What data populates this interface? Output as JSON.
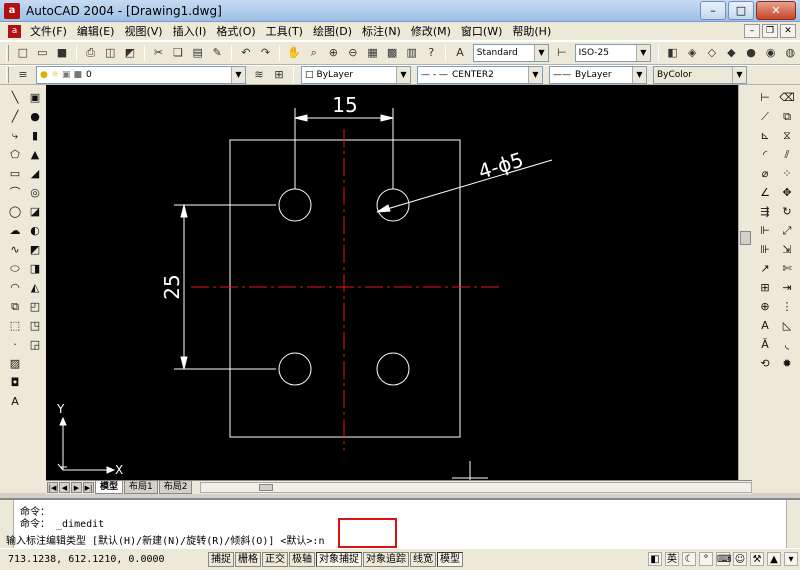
{
  "window": {
    "title": "AutoCAD 2004 - [Drawing1.dwg]",
    "app_icon": "autocad-icon",
    "controls": [
      "minimize-icon",
      "maximize-icon",
      "close-icon"
    ],
    "minimize_glyph": "–",
    "maximize_glyph": "□",
    "close_glyph": "✕",
    "app_icon_glyph": "a",
    "doc_icon_glyph": "a"
  },
  "menu": {
    "items": [
      "文件(F)",
      "编辑(E)",
      "视图(V)",
      "插入(I)",
      "格式(O)",
      "工具(T)",
      "绘图(D)",
      "标注(N)",
      "修改(M)",
      "窗口(W)",
      "帮助(H)"
    ]
  },
  "toolbar": {
    "text_style": "Standard",
    "dim_style": "ISO-25",
    "layer": "0",
    "color": "ByLayer",
    "linetype": "CENTER2",
    "lineweight": "ByLayer",
    "plot_style": "ByColor"
  },
  "drawing": {
    "dim_top": "15",
    "dim_left": "25",
    "leader_note": "4-ϕ5",
    "ucs_y": "Y",
    "ucs_x": "X",
    "colors": {
      "background": "#000000",
      "geometry": "#ffffff",
      "centerline": "#e01818"
    }
  },
  "tabs": {
    "items": [
      "模型",
      "布局1",
      "布局2"
    ],
    "active": "模型",
    "nav": [
      "|◀",
      "◀",
      "▶",
      "▶|"
    ]
  },
  "command": {
    "lines": [
      "命令：",
      "命令：  _dimedit",
      "输入标注编辑类型 [默认(H)/新建(N)/旋转(R)/倾斜(O)] <默认>:n"
    ]
  },
  "status": {
    "coords": "713.1238,  612.1210,  0.0000",
    "toggles": [
      "捕捉",
      "栅格",
      "正交",
      "极轴",
      "对象捕捉",
      "对象追踪",
      "线宽",
      "模型"
    ],
    "tray": [
      "英"
    ]
  },
  "colors": {
    "highlight_box": "#e01010"
  }
}
